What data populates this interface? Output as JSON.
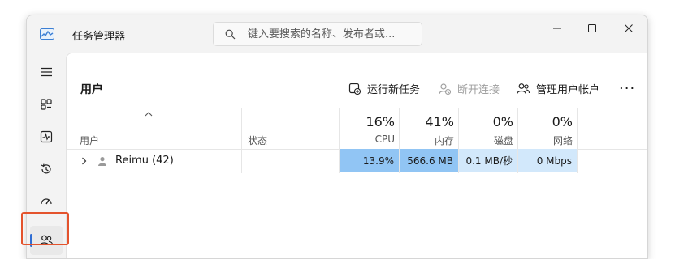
{
  "app": {
    "title": "任务管理器"
  },
  "search": {
    "placeholder": "键入要搜索的名称、发布者或..."
  },
  "sidebar": {
    "items": [
      {
        "icon": "hamburger-menu-icon"
      },
      {
        "icon": "processes-icon"
      },
      {
        "icon": "performance-icon"
      },
      {
        "icon": "app-history-icon"
      },
      {
        "icon": "startup-apps-icon"
      },
      {
        "icon": "users-icon",
        "selected": true
      }
    ]
  },
  "page": {
    "title": "用户"
  },
  "toolbar": {
    "run_task": "运行新任务",
    "disconnect": "断开连接",
    "manage_accounts": "管理用户帐户",
    "more": "···"
  },
  "table": {
    "headers": {
      "user": "用户",
      "status": "状态",
      "cpu": {
        "pct": "16%",
        "name": "CPU"
      },
      "memory": {
        "pct": "41%",
        "name": "内存"
      },
      "disk": {
        "pct": "0%",
        "name": "磁盘"
      },
      "network": {
        "pct": "0%",
        "name": "网络"
      }
    },
    "rows": [
      {
        "name": "Reimu (42)",
        "status": "",
        "cpu": "13.9%",
        "memory": "566.6 MB",
        "disk": "0.1 MB/秒",
        "network": "0 Mbps"
      }
    ]
  },
  "colors": {
    "accent": "#2f6dd3",
    "highlight": "#e4532d",
    "heat_high": "#91c5f4",
    "heat_low": "#d2e8fb"
  }
}
